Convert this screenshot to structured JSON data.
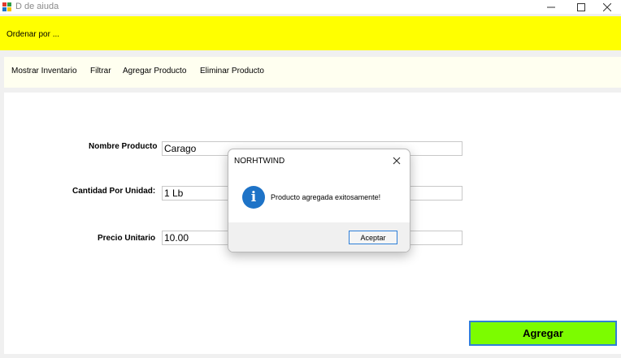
{
  "window": {
    "title": "D de aiuda"
  },
  "header": {
    "sort_label": "Ordenar por ..."
  },
  "menu": {
    "items": [
      {
        "label": "Mostrar Inventario"
      },
      {
        "label": "Filtrar"
      },
      {
        "label": "Agregar Producto"
      },
      {
        "label": "Eliminar Producto"
      }
    ]
  },
  "form": {
    "fields": [
      {
        "label": "Nombre Producto",
        "value": "Carago"
      },
      {
        "label": "Cantidad Por Unidad:",
        "value": "1 Lb"
      },
      {
        "label": "Precio Unitario",
        "value": "10.00"
      }
    ],
    "submit_label": "Agregar"
  },
  "dialog": {
    "title": "NORHTWIND",
    "message": "Producto agregada exitosamente!",
    "ok_label": "Aceptar",
    "icon": "info-icon"
  },
  "colors": {
    "header_bg": "#ffff00",
    "menu_bg": "#fffff0",
    "submit_bg": "#7cfc00",
    "accent_border": "#2f7fd8"
  }
}
